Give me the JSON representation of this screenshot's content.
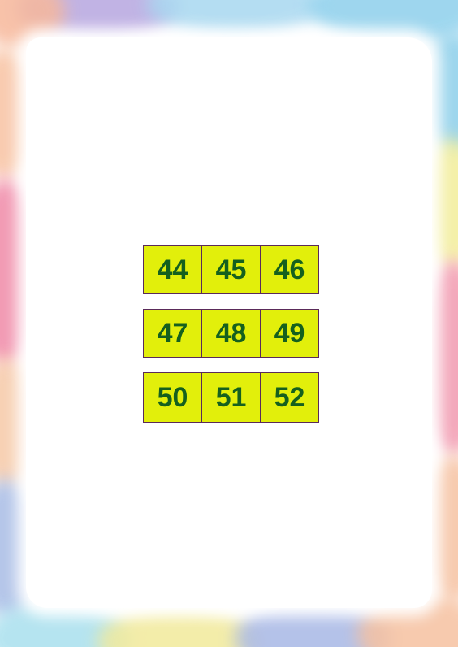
{
  "number_rows": [
    [
      "44",
      "45",
      "46"
    ],
    [
      "47",
      "48",
      "49"
    ],
    [
      "50",
      "51",
      "52"
    ]
  ],
  "colors": {
    "cell_fill": "#e2ef0b",
    "number_text": "#15601e",
    "cell_border": "#5a2a5a",
    "page_background": "#ffffff"
  }
}
